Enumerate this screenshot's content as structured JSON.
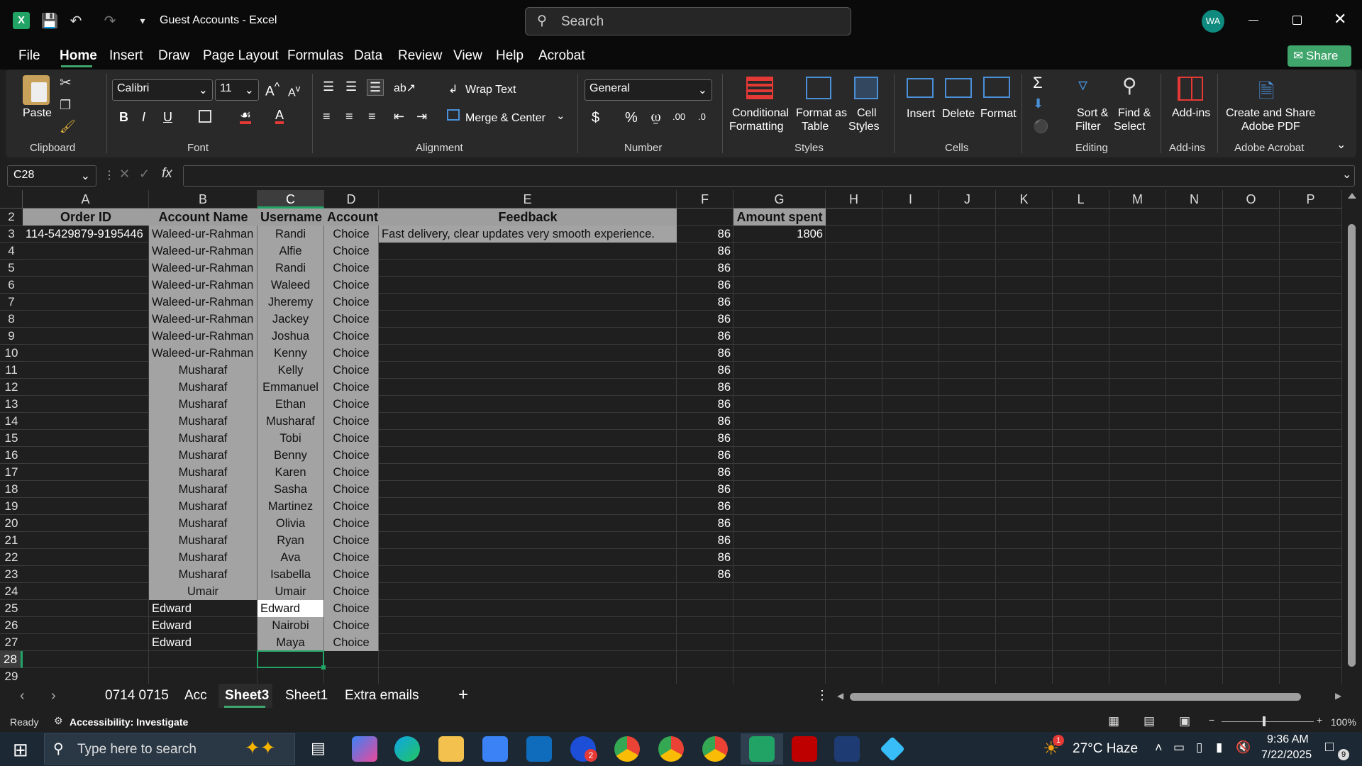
{
  "window": {
    "title": "Guest Accounts  -  Excel",
    "search_placeholder": "Search",
    "user_initials": "WA"
  },
  "menu": [
    "File",
    "Home",
    "Insert",
    "Draw",
    "Page Layout",
    "Formulas",
    "Data",
    "Review",
    "View",
    "Help",
    "Acrobat"
  ],
  "share_label": "Share",
  "ribbon": {
    "paste": "Paste",
    "font_name": "Calibri",
    "font_size": "11",
    "wrap_text": "Wrap Text",
    "merge_center": "Merge & Center",
    "number_format": "General",
    "cond_fmt_1": "Conditional",
    "cond_fmt_2": "Formatting",
    "fmt_table_1": "Format as",
    "fmt_table_2": "Table",
    "cell_styles_1": "Cell",
    "cell_styles_2": "Styles",
    "insert": "Insert",
    "delete": "Delete",
    "format": "Format",
    "sort_1": "Sort &",
    "sort_2": "Filter",
    "find_1": "Find &",
    "find_2": "Select",
    "addins": "Add-ins",
    "pdf_1": "Create and Share",
    "pdf_2": "Adobe PDF",
    "groups": {
      "clipboard": "Clipboard",
      "font": "Font",
      "alignment": "Alignment",
      "number": "Number",
      "styles": "Styles",
      "cells": "Cells",
      "editing": "Editing",
      "addins": "Add-ins",
      "acrobat": "Adobe Acrobat"
    }
  },
  "formula_bar": {
    "name_box": "C28",
    "fx": "fx",
    "value": ""
  },
  "columns": [
    "A",
    "B",
    "C",
    "D",
    "E",
    "F",
    "G",
    "H",
    "I",
    "J",
    "K",
    "L",
    "M",
    "N",
    "O",
    "P"
  ],
  "rows": [
    "2",
    "3",
    "4",
    "5",
    "6",
    "7",
    "8",
    "9",
    "10",
    "11",
    "12",
    "13",
    "14",
    "15",
    "16",
    "17",
    "18",
    "19",
    "20",
    "21",
    "22",
    "23",
    "24",
    "25",
    "26",
    "27",
    "28",
    "29"
  ],
  "headers": {
    "order_id": "Order ID",
    "account_name": "Account Name",
    "username": "Username",
    "account": "Account",
    "feedback": "Feedback",
    "amount_spent": "Amount spent"
  },
  "sheet_rows": [
    {
      "a": "114-5429879-9195446",
      "b": "Waleed-ur-Rahman",
      "c": "Randi",
      "d": "Choice",
      "e": "Fast delivery, clear updates very smooth experience.",
      "f": "86",
      "g": "1806"
    },
    {
      "b": "Waleed-ur-Rahman",
      "c": "Alfie",
      "d": "Choice",
      "f": "86"
    },
    {
      "b": "Waleed-ur-Rahman",
      "c": "Randi",
      "d": "Choice",
      "f": "86"
    },
    {
      "b": "Waleed-ur-Rahman",
      "c": "Waleed",
      "d": "Choice",
      "f": "86"
    },
    {
      "b": "Waleed-ur-Rahman",
      "c": "Jheremy",
      "d": "Choice",
      "f": "86"
    },
    {
      "b": "Waleed-ur-Rahman",
      "c": "Jackey",
      "d": "Choice",
      "f": "86"
    },
    {
      "b": "Waleed-ur-Rahman",
      "c": "Joshua",
      "d": "Choice",
      "f": "86"
    },
    {
      "b": "Waleed-ur-Rahman",
      "c": "Kenny",
      "d": "Choice",
      "f": "86"
    },
    {
      "b": "Musharaf",
      "c": "Kelly",
      "d": "Choice",
      "f": "86"
    },
    {
      "b": "Musharaf",
      "c": "Emmanuel",
      "d": "Choice",
      "f": "86"
    },
    {
      "b": "Musharaf",
      "c": "Ethan",
      "d": "Choice",
      "f": "86"
    },
    {
      "b": "Musharaf",
      "c": "Musharaf",
      "d": "Choice",
      "f": "86"
    },
    {
      "b": "Musharaf",
      "c": "Tobi",
      "d": "Choice",
      "f": "86"
    },
    {
      "b": "Musharaf",
      "c": "Benny",
      "d": "Choice",
      "f": "86"
    },
    {
      "b": "Musharaf",
      "c": "Karen",
      "d": "Choice",
      "f": "86"
    },
    {
      "b": "Musharaf",
      "c": "Sasha",
      "d": "Choice",
      "f": "86"
    },
    {
      "b": "Musharaf",
      "c": "Martinez",
      "d": "Choice",
      "f": "86"
    },
    {
      "b": "Musharaf",
      "c": "Olivia",
      "d": "Choice",
      "f": "86"
    },
    {
      "b": "Musharaf",
      "c": "Ryan",
      "d": "Choice",
      "f": "86"
    },
    {
      "b": "Musharaf",
      "c": "Ava",
      "d": "Choice",
      "f": "86"
    },
    {
      "b": "Musharaf",
      "c": "Isabella",
      "d": "Choice",
      "f": "86"
    },
    {
      "b": "Umair",
      "c": "Umair",
      "d": "Choice"
    },
    {
      "b": "Edward",
      "c": "Edward",
      "d": "Choice"
    },
    {
      "b": "Edward",
      "c": "Nairobi",
      "d": "Choice"
    },
    {
      "b": "Edward",
      "c": "Maya",
      "d": "Choice"
    }
  ],
  "sheet_tabs": [
    "0714 0715",
    "Acc",
    "Sheet3",
    "Sheet1",
    "Extra emails"
  ],
  "active_tab": "Sheet3",
  "status": {
    "ready": "Ready",
    "accessibility": "Accessibility: Investigate",
    "zoom": "100%"
  },
  "taskbar": {
    "search_placeholder": "Type here to search",
    "weather": "27°C  Haze",
    "time": "9:36 AM",
    "date": "7/22/2025",
    "notif": "9",
    "weather_badge": "1",
    "chrome_badge": "2"
  },
  "colors": {
    "cell_gray": "#a3a3a3",
    "header_gray": "#9e9e9e",
    "excel_green": "#217346",
    "share_green": "#3fa56b",
    "selection": "#21a366"
  }
}
